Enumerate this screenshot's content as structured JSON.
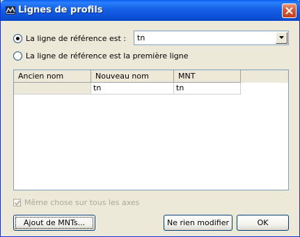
{
  "window": {
    "title": "Lignes de profils"
  },
  "reference": {
    "option_1_label": "La ligne de référence est :",
    "option_2_label": "La ligne de référence est la première ligne",
    "selected_option": 1,
    "combo_value": "tn"
  },
  "table": {
    "columns": [
      "Ancien nom",
      "Nouveau nom",
      "MNT"
    ],
    "rows": [
      [
        "",
        "tn",
        "tn"
      ]
    ]
  },
  "same_all_axes": {
    "label": "Même chose sur tous les axes",
    "checked": true,
    "disabled": true
  },
  "buttons": {
    "add_mnts": "Ajout de MNTs...",
    "no_change": "Ne rien modifier",
    "ok": "OK"
  }
}
